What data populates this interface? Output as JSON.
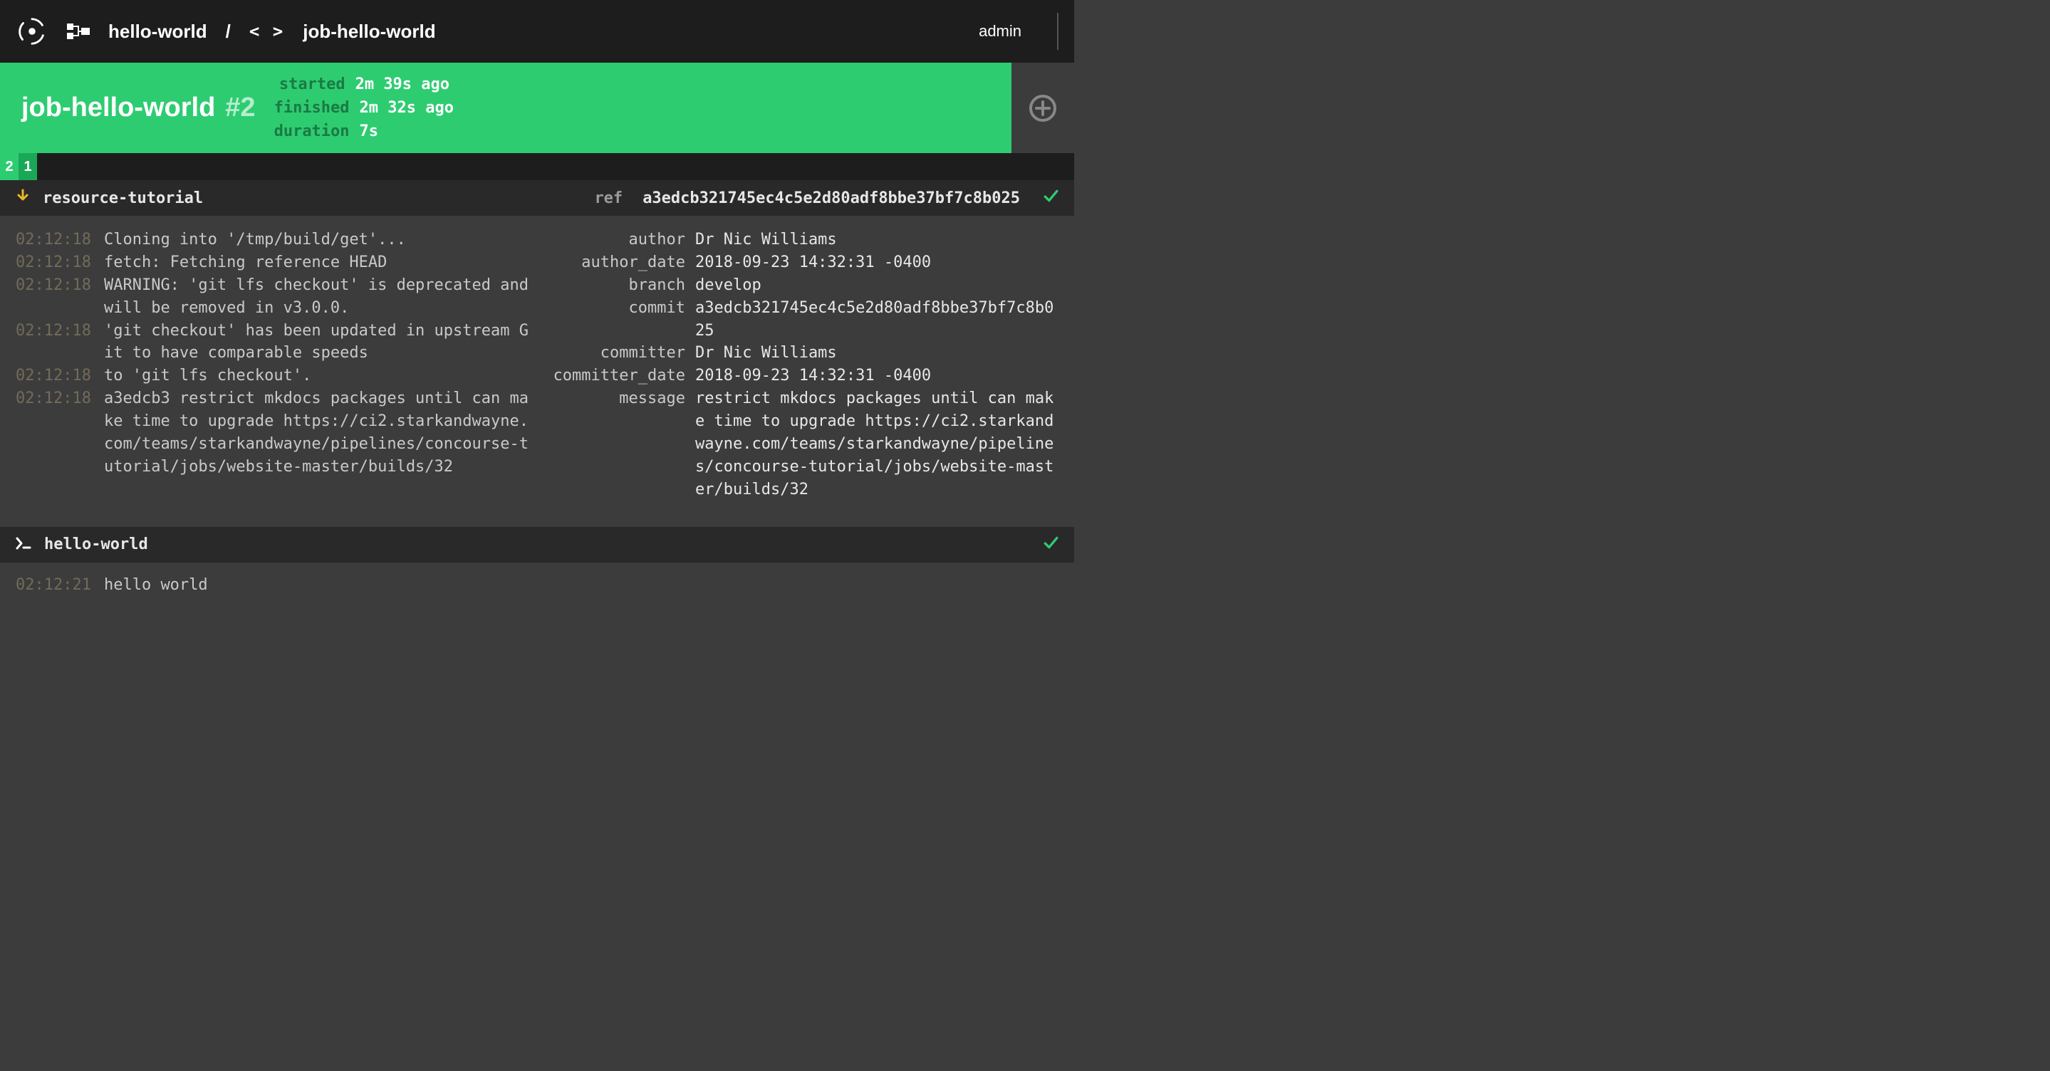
{
  "topbar": {
    "pipeline": "hello-world",
    "job": "job-hello-world",
    "user": "admin"
  },
  "build": {
    "title": "job-hello-world",
    "number": "#2",
    "timing": [
      {
        "k": "started",
        "v": "2m 39s ago"
      },
      {
        "k": "finished",
        "v": "2m 32s ago"
      },
      {
        "k": "duration",
        "v": "7s"
      }
    ],
    "tabs": [
      "2",
      "1"
    ]
  },
  "get_step": {
    "name": "resource-tutorial",
    "ref_key": "ref",
    "ref_val": "a3edcb321745ec4c5e2d80adf8bbe37bf7c8b025",
    "log": [
      {
        "ts": "02:12:18",
        "msg": "Cloning into '/tmp/build/get'..."
      },
      {
        "ts": "02:12:18",
        "msg": "fetch: Fetching reference HEAD"
      },
      {
        "ts": "02:12:18",
        "msg": "WARNING: 'git lfs checkout' is deprecated and will be removed in v3.0.0."
      },
      {
        "ts": "02:12:18",
        "msg": "'git checkout' has been updated in upstream Git to have comparable speeds"
      },
      {
        "ts": "02:12:18",
        "msg": "to 'git lfs checkout'."
      },
      {
        "ts": "02:12:18",
        "msg": "a3edcb3 restrict mkdocs packages until can make time to upgrade https://ci2.starkandwayne.com/teams/starkandwayne/pipelines/concourse-tutorial/jobs/website-master/builds/32"
      }
    ],
    "meta": [
      {
        "k": "author",
        "v": "Dr Nic Williams"
      },
      {
        "k": "author_date",
        "v": "2018-09-23 14:32:31 -0400"
      },
      {
        "k": "branch",
        "v": "develop"
      },
      {
        "k": "commit",
        "v": "a3edcb321745ec4c5e2d80adf8bbe37bf7c8b025"
      },
      {
        "k": "committer",
        "v": "Dr Nic Williams"
      },
      {
        "k": "committer_date",
        "v": "2018-09-23 14:32:31 -0400"
      },
      {
        "k": "message",
        "v": "restrict mkdocs packages until can make time to upgrade https://ci2.starkandwayne.com/teams/starkandwayne/pipelines/concourse-tutorial/jobs/website-master/builds/32"
      }
    ]
  },
  "task_step": {
    "name": "hello-world",
    "log": [
      {
        "ts": "02:12:21",
        "msg": "hello world"
      }
    ]
  }
}
